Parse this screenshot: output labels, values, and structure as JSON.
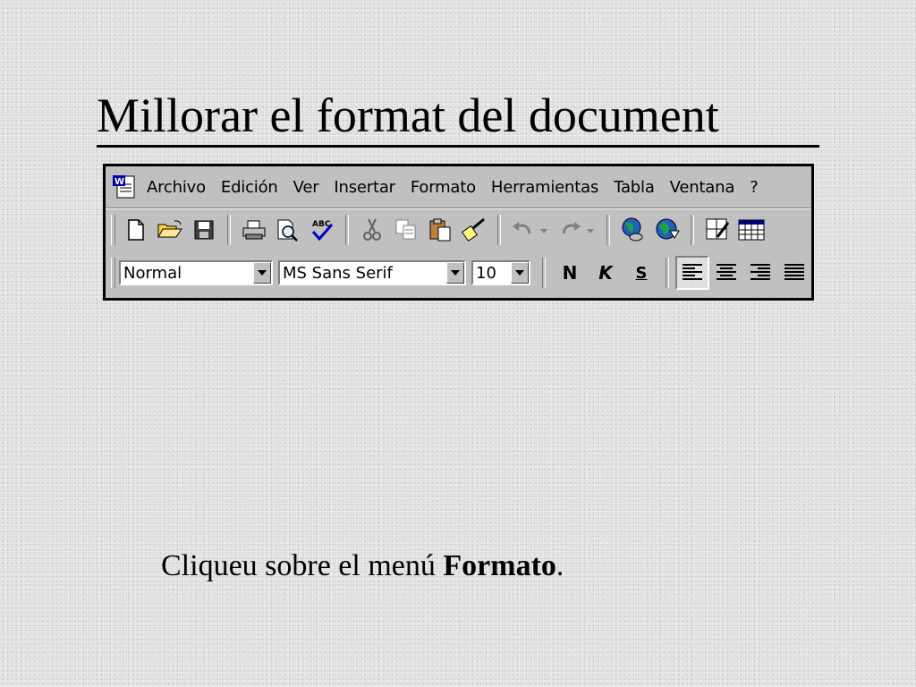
{
  "slide": {
    "title": "Millorar el format del document",
    "caption_prefix": "Cliqueu sobre el menú ",
    "caption_bold": "Formato",
    "caption_suffix": "."
  },
  "menubar": {
    "items": [
      {
        "label": "Archivo"
      },
      {
        "label": "Edición"
      },
      {
        "label": "Ver"
      },
      {
        "label": "Insertar"
      },
      {
        "label": "Formato"
      },
      {
        "label": "Herramientas"
      },
      {
        "label": "Tabla"
      },
      {
        "label": "Ventana"
      },
      {
        "label": "?"
      }
    ]
  },
  "toolbar_standard": {
    "icons": [
      "new-document-icon",
      "open-folder-icon",
      "save-icon",
      "print-icon",
      "print-preview-icon",
      "spelling-icon",
      "cut-icon",
      "copy-icon",
      "paste-icon",
      "format-painter-icon",
      "undo-icon",
      "redo-icon",
      "insert-hyperlink-icon",
      "web-toolbar-icon",
      "tables-borders-icon",
      "insert-table-icon"
    ]
  },
  "toolbar_formatting": {
    "style_value": "Normal",
    "font_value": "MS Sans Serif",
    "size_value": "10",
    "bold_label": "N",
    "italic_label": "K",
    "underline_label": "S"
  },
  "colors": {
    "chrome": "#c0c0c0",
    "frame": "#000000",
    "slide_bg": "#dcdcdc"
  }
}
